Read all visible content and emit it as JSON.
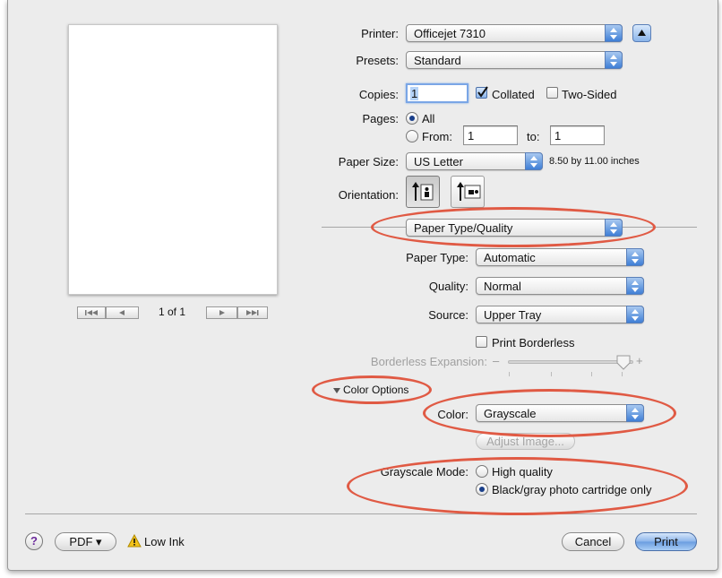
{
  "printer": {
    "label": "Printer:",
    "value": "Officejet 7310"
  },
  "presets": {
    "label": "Presets:",
    "value": "Standard"
  },
  "copies": {
    "label": "Copies:",
    "value": "1",
    "collated_label": "Collated",
    "collated_checked": true,
    "two_sided_label": "Two-Sided",
    "two_sided_checked": false
  },
  "pages": {
    "label": "Pages:",
    "all_label": "All",
    "from_label": "From:",
    "from_value": "1",
    "to_label": "to:",
    "to_value": "1",
    "selected": "all"
  },
  "paper_size": {
    "label": "Paper Size:",
    "value": "US Letter",
    "dimensions": "8.50 by 11.00 inches"
  },
  "orientation": {
    "label": "Orientation:"
  },
  "section_menu": {
    "value": "Paper Type/Quality"
  },
  "paper_type": {
    "label": "Paper Type:",
    "value": "Automatic"
  },
  "quality": {
    "label": "Quality:",
    "value": "Normal"
  },
  "source": {
    "label": "Source:",
    "value": "Upper Tray"
  },
  "borderless": {
    "print_label": "Print Borderless",
    "checked": false,
    "expansion_label": "Borderless Expansion:",
    "minus": "–",
    "plus": "+"
  },
  "color_options": {
    "disclosure_label": "Color Options"
  },
  "color": {
    "label": "Color:",
    "value": "Grayscale",
    "adjust_label": "Adjust Image..."
  },
  "grayscale_mode": {
    "label": "Grayscale Mode:",
    "option_high": "High quality",
    "option_black": "Black/gray photo cartridge only",
    "selected": "black"
  },
  "preview": {
    "page_counter": "1 of 1"
  },
  "footer": {
    "help_label": "?",
    "pdf_label": "PDF ▾",
    "low_ink_label": "Low Ink",
    "cancel_label": "Cancel",
    "print_label": "Print"
  },
  "colors": {
    "annotation": "#e05a44",
    "accent": "#3f7fd6"
  }
}
